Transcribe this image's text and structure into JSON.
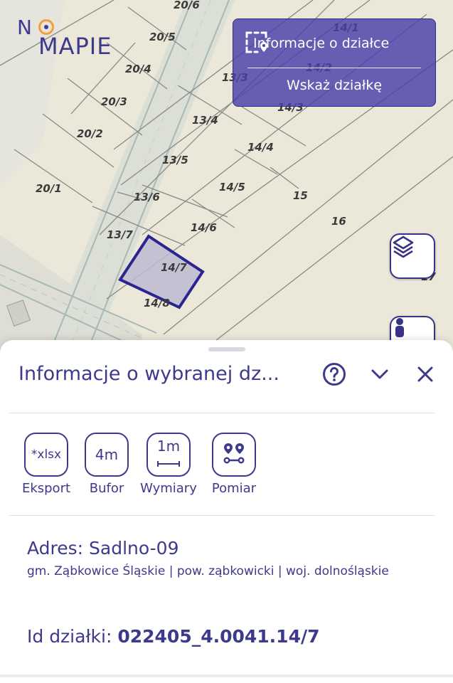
{
  "logo": {
    "no": "N",
    "mapie": "MAPIE"
  },
  "map": {
    "plot_labels": [
      "20/6",
      "20/5",
      "20/4",
      "20/3",
      "20/2",
      "20/1",
      "13/3",
      "13/4",
      "13/5",
      "13/6",
      "13/7",
      "14/1",
      "14/2",
      "14/3",
      "14/4",
      "14/5",
      "14/6",
      "14/7",
      "14/8",
      "15",
      "16",
      "17"
    ],
    "selected_plot": "14/7",
    "info_panel": {
      "info_label": "Informacje o działce",
      "select_label": "Wskaż działkę"
    }
  },
  "sheet": {
    "title": "Informacje o wybranej dz...",
    "tools": [
      {
        "icon_text": "*xlsx",
        "label": "Eksport"
      },
      {
        "icon_text": "4m",
        "label": "Bufor"
      },
      {
        "icon_text": "1m",
        "label": "Wymiary"
      },
      {
        "icon_text": "",
        "label": "Pomiar"
      }
    ],
    "address_label": "Adres: Sadlno-09",
    "address_details": "gm. Ząbkowice Śląskie | pow. ząbkowicki | woj. dolnośląskie",
    "parcel_id_label": "Id działki: ",
    "parcel_id_value": "022405_4.0041.14/7"
  },
  "icons": [
    "select-area-icon",
    "layers-icon",
    "person-icon",
    "help-icon",
    "chevron-down-icon",
    "close-icon",
    "route-icon"
  ],
  "colors": {
    "brand": "#3d3a8c",
    "accent": "#f2a03a",
    "panel": "#483faa",
    "selected_fill": "#bcbad0"
  }
}
